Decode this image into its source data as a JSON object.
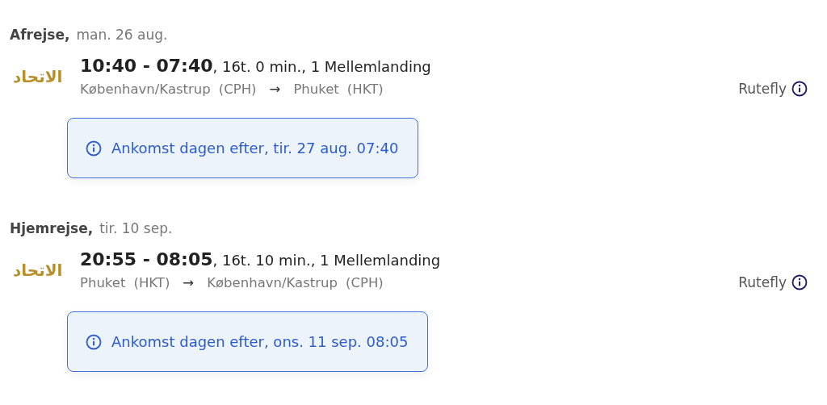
{
  "legs": [
    {
      "label": "Afrejse,",
      "date": "man. 26 aug.",
      "airline_logo": "الاتحاد",
      "times": "10:40 - 07:40",
      "details": ", 16t. 0 min., 1 Mellemlanding",
      "from": {
        "city": "København/Kastrup",
        "code": "(CPH)"
      },
      "arrow": "→",
      "to": {
        "city": "Phuket",
        "code": "(HKT)"
      },
      "fare_type": "Rutefly",
      "notice": "Ankomst dagen efter, tir. 27 aug. 07:40"
    },
    {
      "label": "Hjemrejse,",
      "date": "tir. 10 sep.",
      "airline_logo": "الاتحاد",
      "times": "20:55 - 08:05",
      "details": ", 16t. 10 min., 1 Mellemlanding",
      "from": {
        "city": "Phuket",
        "code": "(HKT)"
      },
      "arrow": "→",
      "to": {
        "city": "København/Kastrup",
        "code": "(CPH)"
      },
      "fare_type": "Rutefly",
      "notice": "Ankomst dagen efter, ons. 11 sep. 08:05"
    }
  ]
}
